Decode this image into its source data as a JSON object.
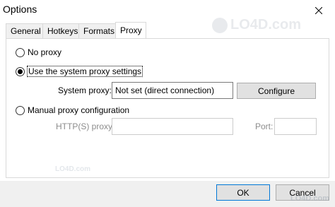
{
  "window": {
    "title": "Options"
  },
  "tabs": [
    {
      "label": "General"
    },
    {
      "label": "Hotkeys"
    },
    {
      "label": "Formats"
    },
    {
      "label": "Proxy"
    }
  ],
  "active_tab": "Proxy",
  "proxy": {
    "no_proxy_label": "No proxy",
    "system_label": "Use the system proxy settings",
    "system_proxy_label": "System proxy:",
    "system_proxy_value": "Not set (direct connection)",
    "configure_label": "Configure",
    "manual_label": "Manual proxy configuration",
    "http_label": "HTTP(S) proxy:",
    "http_value": "",
    "port_label": "Port:",
    "port_value": "",
    "selected": "system"
  },
  "buttons": {
    "ok": "OK",
    "cancel": "Cancel"
  },
  "watermark": {
    "text": "LO4D.com"
  },
  "icons": {
    "close": "close-icon"
  }
}
